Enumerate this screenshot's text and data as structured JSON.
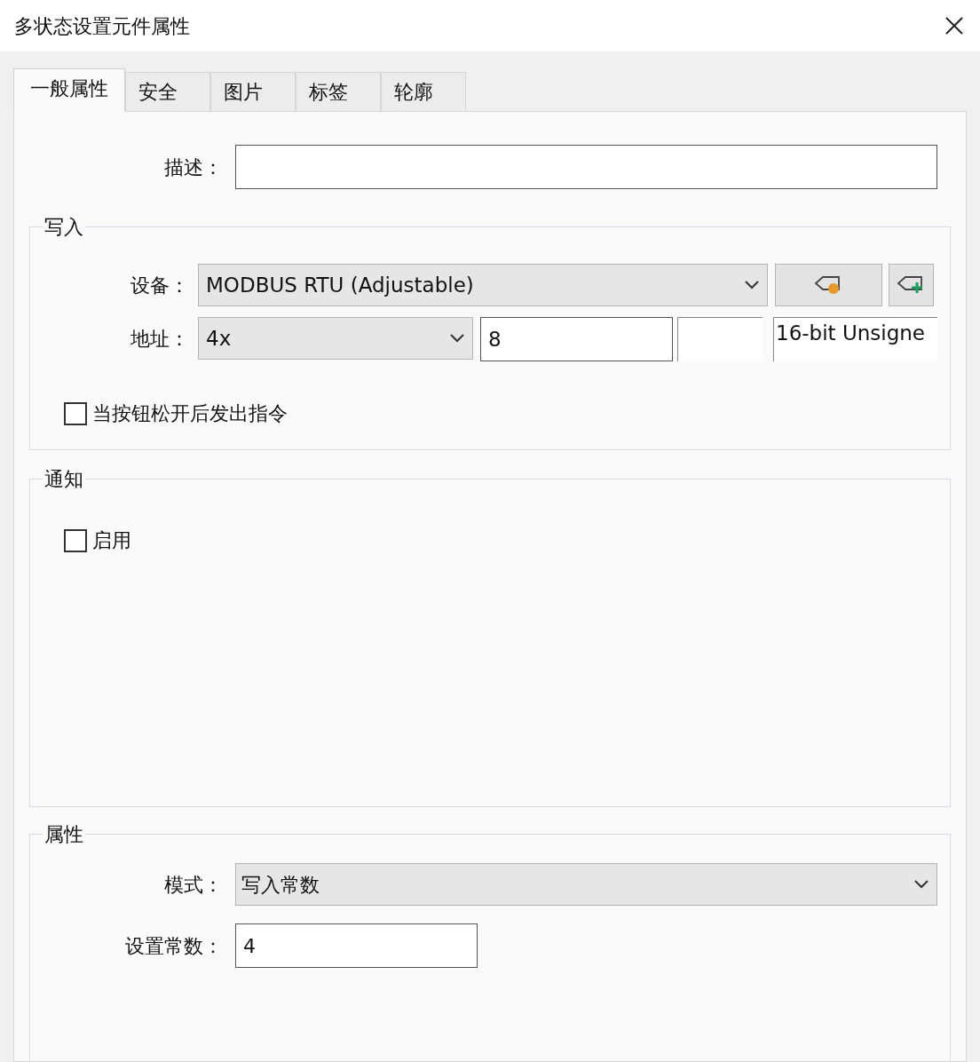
{
  "window": {
    "title": "多状态设置元件属性"
  },
  "tabs": [
    {
      "label": "一般属性",
      "selected": true
    },
    {
      "label": "安全",
      "selected": false
    },
    {
      "label": "图片",
      "selected": false
    },
    {
      "label": "标签",
      "selected": false
    },
    {
      "label": "轮廓",
      "selected": false
    }
  ],
  "description": {
    "label": "描述："
  },
  "write_group": {
    "title": "写入",
    "device": {
      "label": "设备：",
      "value": "MODBUS RTU (Adjustable)"
    },
    "address": {
      "label": "地址：",
      "type": "4x",
      "value": "8",
      "data_type": "16-bit Unsigne"
    },
    "release_checkbox": {
      "label": "当按钮松开后发出指令",
      "checked": false
    }
  },
  "notify_group": {
    "title": "通知",
    "enable": {
      "label": "启用",
      "checked": false
    }
  },
  "properties_group": {
    "title": "属性",
    "mode": {
      "label": "模式：",
      "value": "写入常数"
    },
    "constant": {
      "label": "设置常数：",
      "value": "4"
    }
  }
}
